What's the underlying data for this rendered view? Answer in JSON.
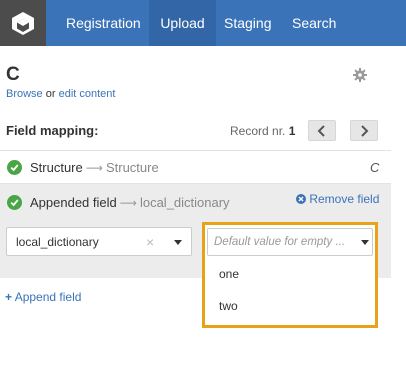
{
  "nav": {
    "items": [
      {
        "label": "Registration"
      },
      {
        "label": "Upload"
      },
      {
        "label": "Staging"
      },
      {
        "label": "Search"
      }
    ],
    "active": "Upload"
  },
  "header": {
    "title": "C",
    "browse_label": "Browse",
    "or_text": "or",
    "edit_label": "edit content"
  },
  "field_mapping": {
    "title": "Field mapping:",
    "record_label": "Record nr.",
    "record_number": "1"
  },
  "rows": [
    {
      "source": "Structure",
      "target": "Structure",
      "right_text": "C"
    },
    {
      "source": "Appended field",
      "target": "local_dictionary",
      "remove_label": "Remove field"
    }
  ],
  "appended_controls": {
    "field_select_value": "local_dictionary",
    "default_value_placeholder": "Default value for empty ...",
    "dropdown_options": [
      "one",
      "two"
    ]
  },
  "append_field_label": "Append field",
  "colors": {
    "nav_bg": "#3b73b9",
    "nav_active": "#3266a6",
    "logo_bg": "#4c4c4c",
    "check_green": "#4aa546",
    "highlight_border": "#e8a217",
    "link": "#3b73b9"
  },
  "icons": [
    "logo-cube-icon",
    "gear-icon",
    "chevron-left-icon",
    "chevron-right-icon",
    "check-circle-icon",
    "arrow-right-icon",
    "close-circle-icon",
    "clear-x-icon",
    "caret-down-icon",
    "plus-icon"
  ]
}
